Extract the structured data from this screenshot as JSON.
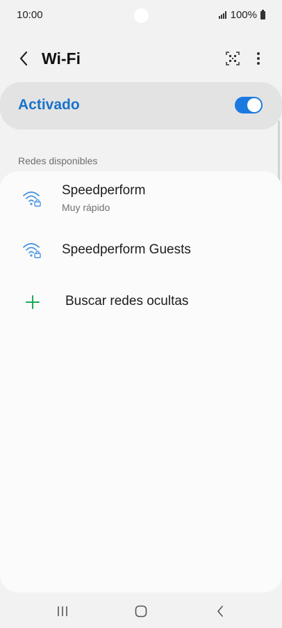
{
  "status_bar": {
    "time": "10:00",
    "battery_text": "100%",
    "signal_icon": "cellular-signal-icon",
    "battery_icon": "battery-icon"
  },
  "header": {
    "title": "Wi-Fi",
    "back_icon": "chevron-left-icon",
    "qr_icon": "qr-code-scan-icon",
    "more_icon": "more-vertical-icon"
  },
  "master_switch": {
    "label": "Activado",
    "state": "on",
    "accent_color": "#1a73c9",
    "toggle_color": "#1a7ae0"
  },
  "available_networks": {
    "section_label": "Redes disponibles",
    "networks": [
      {
        "name": "Speedperform",
        "subtitle": "Muy rápido",
        "icon": "wifi-locked-icon"
      },
      {
        "name": "Speedperform Guests",
        "icon": "wifi-locked-icon"
      }
    ],
    "add_network": {
      "label": "Buscar redes ocultas",
      "icon": "plus-icon",
      "icon_color": "#1ea85b"
    }
  },
  "nav_bar": {
    "recents_icon": "recent-apps-icon",
    "home_icon": "home-icon",
    "back_icon": "back-icon"
  }
}
